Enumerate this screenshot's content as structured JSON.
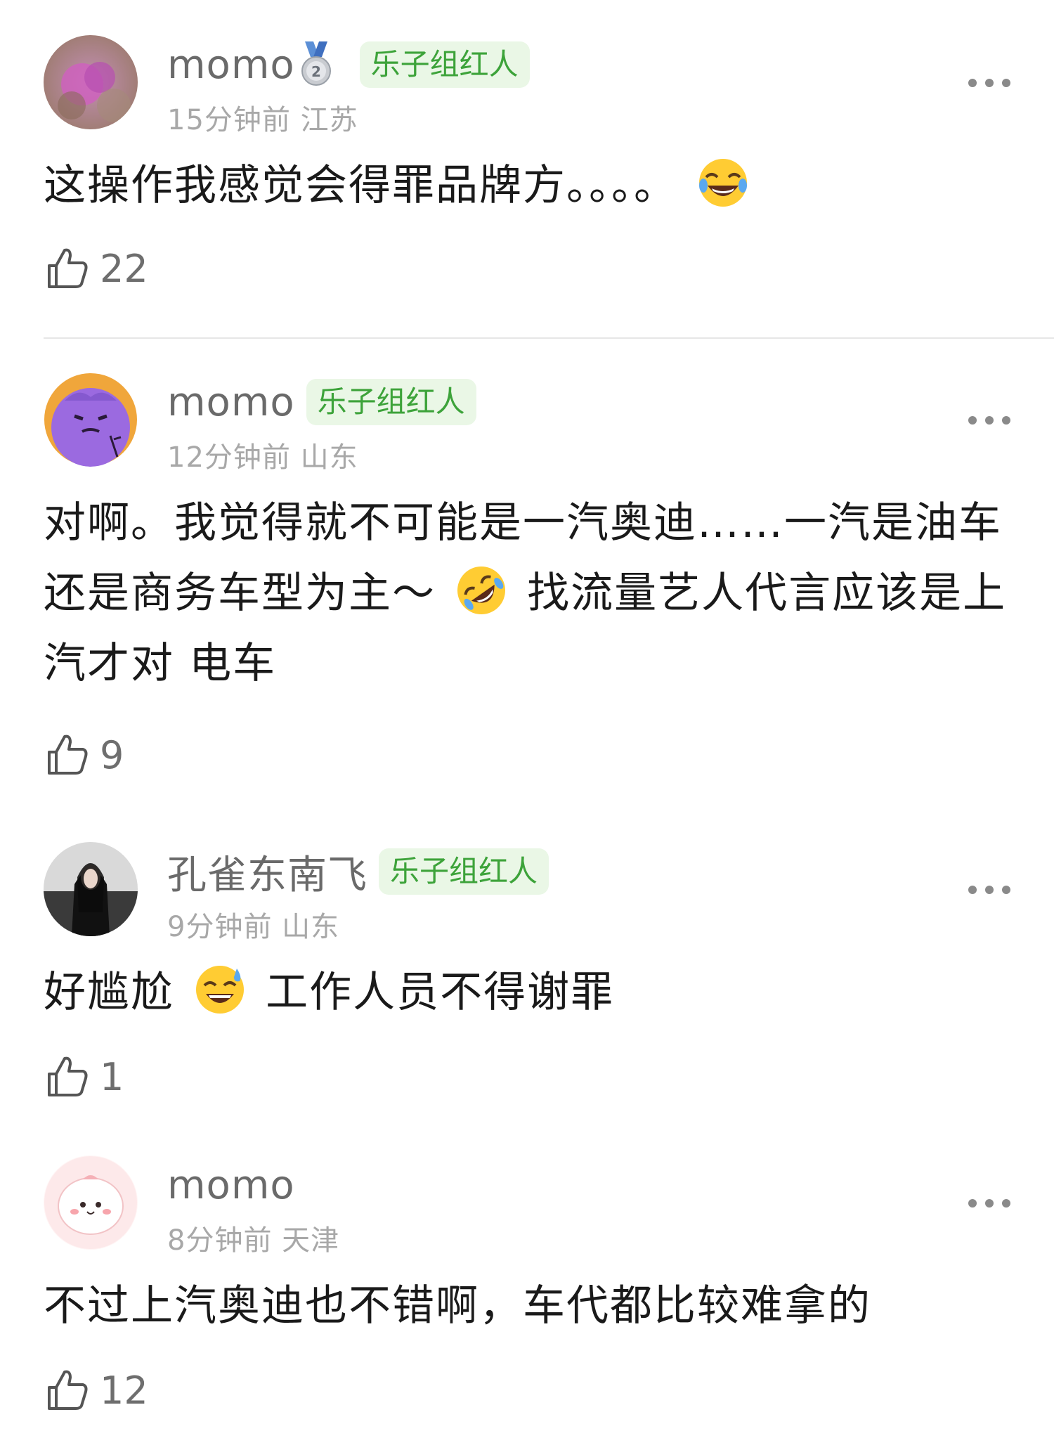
{
  "comments": [
    {
      "username": "momo",
      "badge": "乐子组红人",
      "time": "15分钟前",
      "location": "江苏",
      "text_before": "这操作我感觉会得罪品牌方。。。。",
      "text_after": "",
      "emoji": "joy-emoji",
      "likes": "22",
      "has_medal": true
    },
    {
      "username": "momo",
      "badge": "乐子组红人",
      "time": "12分钟前",
      "location": "山东",
      "text_before": "对啊。我觉得就不可能是一汽奥迪……一汽是油车还是商务车型为主～",
      "text_after": " 找流量艺人代言应该是上汽才对 电车",
      "emoji": "rofl-emoji",
      "likes": "9"
    },
    {
      "username": "孔雀东南飞",
      "badge": "乐子组红人",
      "time": "9分钟前",
      "location": "山东",
      "text_before": "好尴尬",
      "text_after": " 工作人员不得谢罪",
      "emoji": "sweat-smile-emoji",
      "likes": "1"
    },
    {
      "username": "momo",
      "badge": "",
      "time": "8分钟前",
      "location": "天津",
      "text_before": "不过上汽奥迪也不错啊，车代都比较难拿的",
      "text_after": "",
      "emoji": "",
      "likes": "12"
    }
  ],
  "colors": {
    "badge_bg": "#eaf7e6",
    "badge_text": "#3da33a",
    "meta_text": "#a8a8a8",
    "username_text": "#6a6a6a"
  },
  "icons": {
    "like": "thumbs-up-icon",
    "more": "more-horizontal-icon",
    "medal": "silver-medal-icon"
  }
}
